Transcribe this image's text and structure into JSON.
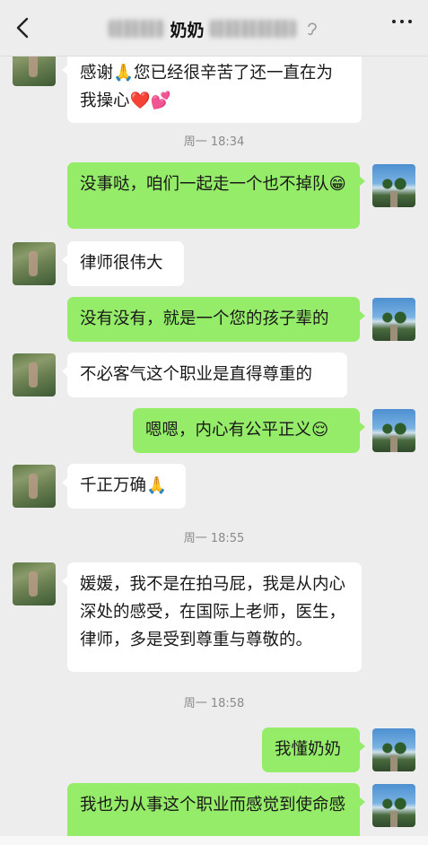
{
  "header": {
    "title": "奶奶",
    "back_icon": "chevron-left-icon",
    "more_icon": "more-dots-icon",
    "ear_icon": "ear-icon"
  },
  "messages": [
    {
      "side": "left",
      "text": "感谢🙏您已经很辛苦了还一直在为我操心❤️💕"
    },
    {
      "side": "time",
      "text": "周一 18:34"
    },
    {
      "side": "right",
      "text": "没事哒，咱们一起走一个也不掉队😁"
    },
    {
      "side": "left",
      "text": "律师很伟大"
    },
    {
      "side": "right",
      "text": "没有没有，就是一个您的孩子辈的"
    },
    {
      "side": "left",
      "text": "不必客气这个职业是直得尊重的"
    },
    {
      "side": "right",
      "text": "嗯嗯，内心有公平正义😌"
    },
    {
      "side": "left",
      "text": "千正万确🙏"
    },
    {
      "side": "time",
      "text": "周一 18:55"
    },
    {
      "side": "left",
      "text": "媛媛，我不是在拍马屁，我是从内心深处的感受，在国际上老师，医生，律师，多是受到尊重与尊敬的。"
    },
    {
      "side": "time",
      "text": "周一 18:58"
    },
    {
      "side": "right",
      "text": "我懂奶奶"
    },
    {
      "side": "right",
      "text": "我也为从事这个职业而感觉到使命感"
    }
  ],
  "colors": {
    "bg": "#ededed",
    "self_bubble": "#95ec69",
    "other_bubble": "#ffffff",
    "time": "#8a8a8a"
  }
}
